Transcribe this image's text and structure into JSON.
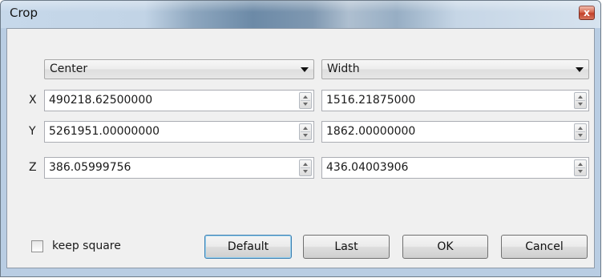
{
  "window": {
    "title": "Crop",
    "close_label": "x"
  },
  "modes": {
    "position_mode": "Center",
    "size_mode": "Width"
  },
  "rows": [
    {
      "axis": "X",
      "position": "490218.62500000",
      "size": "1516.21875000"
    },
    {
      "axis": "Y",
      "position": "5261951.00000000",
      "size": "1862.00000000"
    },
    {
      "axis": "Z",
      "position": "386.05999756",
      "size": "436.04003906"
    }
  ],
  "keep_square": {
    "label": "keep square",
    "checked": false
  },
  "buttons": {
    "default": "Default",
    "last": "Last",
    "ok": "OK",
    "cancel": "Cancel"
  },
  "colors": {
    "close_button": "#c2402a",
    "dialog_background": "#f0f0f0",
    "default_button_border": "#3c7fb1"
  }
}
